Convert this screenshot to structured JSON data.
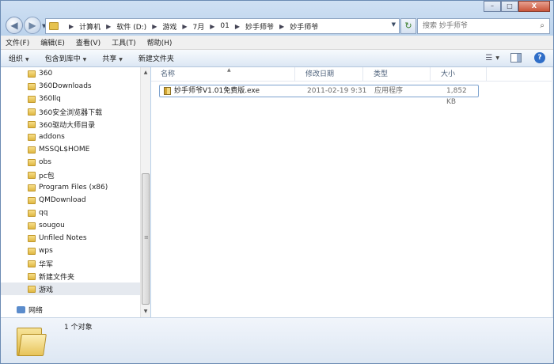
{
  "window": {
    "minimize": "–",
    "maximize": "□",
    "close": "X"
  },
  "address": {
    "segments": [
      "计算机",
      "软件 (D:)",
      "游戏",
      "7月",
      "01",
      "妙手师爷",
      "妙手师爷"
    ],
    "search_placeholder": "搜索 妙手师爷"
  },
  "menubar": [
    "文件(F)",
    "编辑(E)",
    "查看(V)",
    "工具(T)",
    "帮助(H)"
  ],
  "toolbar": {
    "organize": "组织",
    "include_in_library": "包含到库中",
    "share": "共享",
    "new_folder": "新建文件夹"
  },
  "sidebar": {
    "folders": [
      "360",
      "360Downloads",
      "360llq",
      "360安全浏览器下载",
      "360驱动大师目录",
      "addons",
      "MSSQL$HOME",
      "obs",
      "pc包",
      "Program Files (x86)",
      "QMDownload",
      "qq",
      "sougou",
      "Unfiled Notes",
      "wps",
      "华军",
      "新建文件夹",
      "游戏"
    ],
    "selected": "游戏",
    "network": "网络"
  },
  "columns": {
    "name": "名称",
    "date": "修改日期",
    "type": "类型",
    "size": "大小"
  },
  "files": [
    {
      "name": "妙手师爷V1.01免费版.exe",
      "date": "2011-02-19 9:31",
      "type": "应用程序",
      "size": "1,852 KB"
    }
  ],
  "details": {
    "item_count": "1 个对象"
  }
}
